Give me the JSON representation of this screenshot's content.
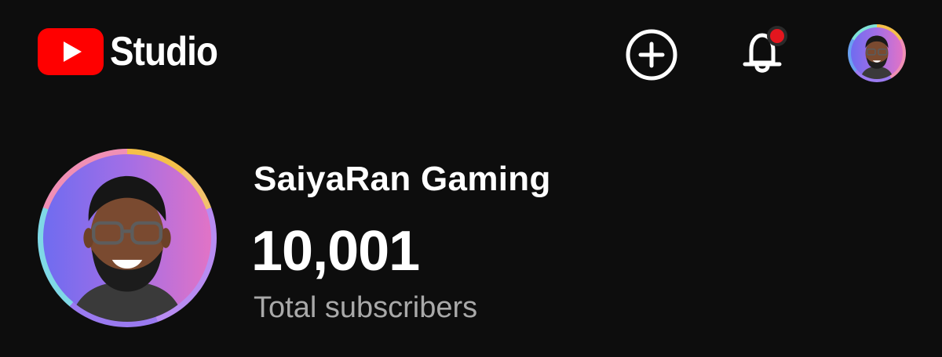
{
  "header": {
    "app_name": "Studio",
    "logo_icon": "youtube-play-icon",
    "create_icon": "plus-circle-icon",
    "notifications_icon": "bell-icon",
    "has_unread_notification": true,
    "profile_icon": "avatar"
  },
  "channel": {
    "name": "SaiyaRan Gaming",
    "subscriber_count": "10,001",
    "subscriber_label": "Total subscribers"
  },
  "colors": {
    "background": "#0d0d0d",
    "brand_red": "#ff0000",
    "notification_dot": "#e3161e",
    "secondary_text": "#a9a9a9"
  }
}
